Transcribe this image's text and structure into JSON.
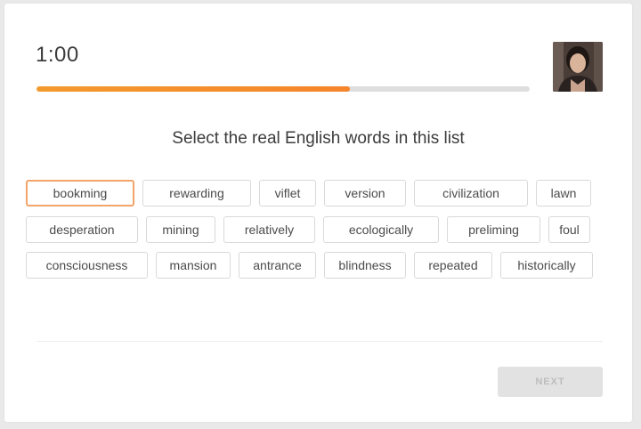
{
  "timer": {
    "display": "1:00"
  },
  "progress": {
    "fraction": 0.635,
    "color": "#f5852b"
  },
  "webcam": {
    "icon": "webcam-video-icon"
  },
  "prompt": "Select the real English words in this list",
  "words": {
    "row1": [
      "bookming",
      "rewarding",
      "viflet",
      "version",
      "civilization",
      "lawn"
    ],
    "row2": [
      "desperation",
      "mining",
      "relatively",
      "ecologically",
      "preliming",
      "foul"
    ],
    "row3": [
      "consciousness",
      "mansion",
      "antrance",
      "blindness",
      "repeated",
      "historically"
    ]
  },
  "selected_word": "bookming",
  "next_label": "NEXT"
}
